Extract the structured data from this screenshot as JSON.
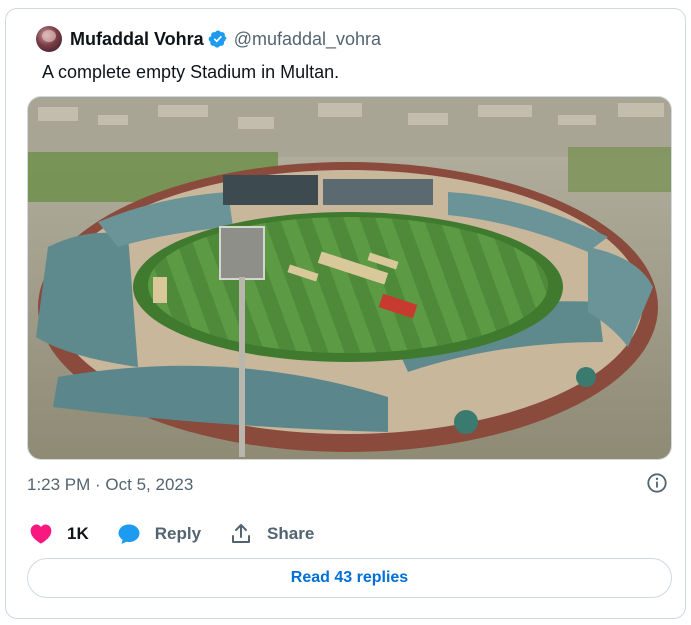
{
  "tweet": {
    "author_name": "Mufaddal Vohra",
    "handle": "@mufaddal_vohra",
    "verified": true,
    "text": "A complete empty Stadium in Multan.",
    "timestamp": "1:23 PM · Oct 5, 2023",
    "media": {
      "type": "photo",
      "icon": "stadium-photo"
    }
  },
  "actions": {
    "likes_count": "1K",
    "reply_label": "Reply",
    "share_label": "Share"
  },
  "read_replies_label": "Read 43 replies",
  "colors": {
    "like_heart": "#f91880",
    "reply_bubble": "#1d9bf0",
    "verified_badge": "#1d9bf0",
    "link_blue": "#006fd6",
    "muted_text": "#536471",
    "border": "#cfd9de"
  },
  "icons": [
    "verified-badge-icon",
    "info-icon",
    "heart-icon",
    "reply-bubble-icon",
    "share-icon"
  ]
}
